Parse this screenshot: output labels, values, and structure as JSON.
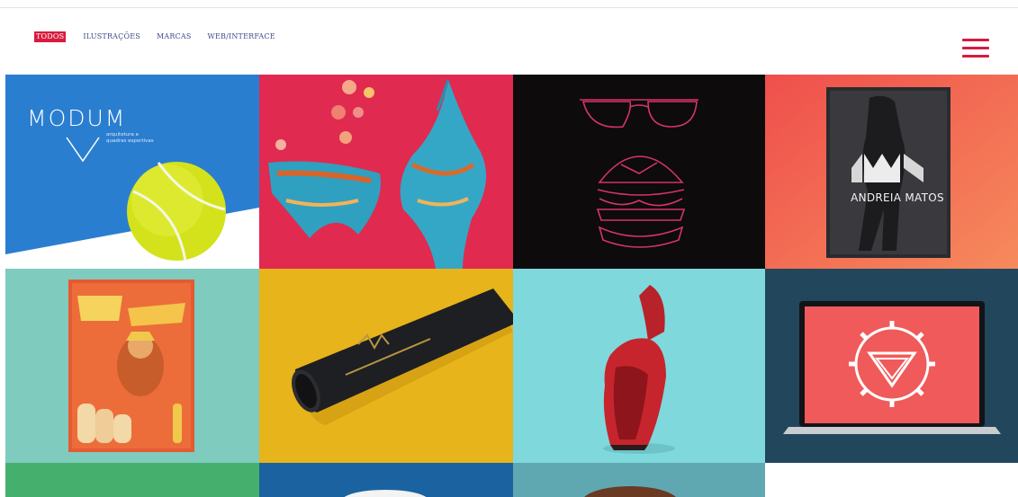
{
  "nav": {
    "filters": [
      {
        "label": "TODOS",
        "active": true
      },
      {
        "label": "ILUSTRAÇÕES",
        "active": false
      },
      {
        "label": "MARCAS",
        "active": false
      },
      {
        "label": "WEB/INTERFACE",
        "active": false
      }
    ],
    "menu_icon": "hamburger-menu-icon"
  },
  "colors": {
    "accent": "#d81b3f",
    "nav_text": "#3c4a8a"
  },
  "portfolio": {
    "tiles": [
      {
        "name": "modum",
        "background": "#2a7ed0",
        "brand": "MODUM",
        "tagline": "arquitetura e quadras esportivas"
      },
      {
        "name": "swimwear",
        "background": "#e02a4f"
      },
      {
        "name": "burger-glasses",
        "background": "#0d0b0c"
      },
      {
        "name": "andreia-matos",
        "background": "#f46a55",
        "brand": "ANDREIA MATOS"
      },
      {
        "name": "tequila-poster",
        "background": "#7fcbbe"
      },
      {
        "name": "tube-packaging",
        "background": "#e8b41b"
      },
      {
        "name": "red-shoe",
        "background": "#7fd8dc"
      },
      {
        "name": "laptop-logo",
        "background": "#22465c"
      },
      {
        "name": "partial-green",
        "background": "#45b06e"
      },
      {
        "name": "partial-blue",
        "background": "#1b63a0"
      },
      {
        "name": "partial-teal",
        "background": "#5fa8b2"
      }
    ]
  }
}
